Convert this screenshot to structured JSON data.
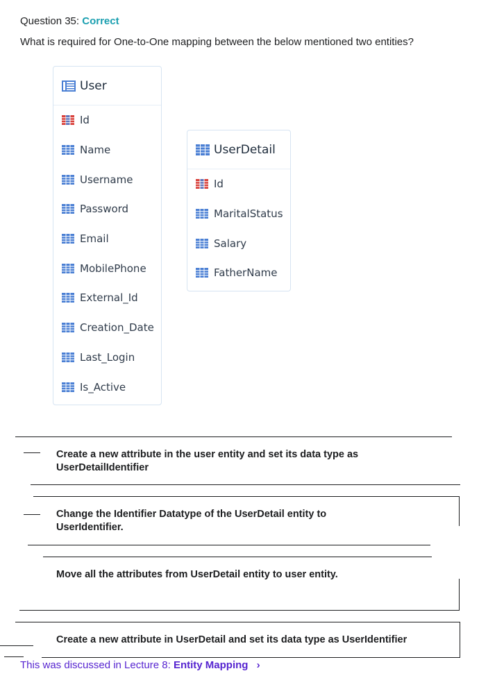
{
  "question": {
    "label": "Question 35:",
    "status": "Correct",
    "text": "What is required for One-to-One mapping between the below mentioned two entities?"
  },
  "entities": {
    "user": {
      "title": "User",
      "attributes": [
        "Id",
        "Name",
        "Username",
        "Password",
        "Email",
        "MobilePhone",
        "External_Id",
        "Creation_Date",
        "Last_Login",
        "Is_Active"
      ]
    },
    "user_detail": {
      "title": "UserDetail",
      "attributes": [
        "Id",
        "MaritalStatus",
        "Salary",
        "FatherName"
      ]
    }
  },
  "options": [
    "Create a new attribute in the user entity and set its data type as UserDetailIdentifier",
    "Change the Identifier Datatype of the UserDetail entity to UserIdentifier.",
    "Move all the attributes from UserDetail entity to user entity.",
    "Create a new attribute in UserDetail and set its data type as UserIdentifier"
  ],
  "footer": {
    "prefix": "This was discussed in Lecture 8:",
    "lecture": "Entity Mapping",
    "chevron": "›"
  },
  "colors": {
    "correct": "#1a9fb0",
    "link": "#5624d0",
    "attr_icon": "#4a7fd4",
    "key_icon": "#d9413b"
  },
  "icons": {
    "entity": "table-icon",
    "attribute": "attribute-icon",
    "key": "identifier-key-icon"
  }
}
